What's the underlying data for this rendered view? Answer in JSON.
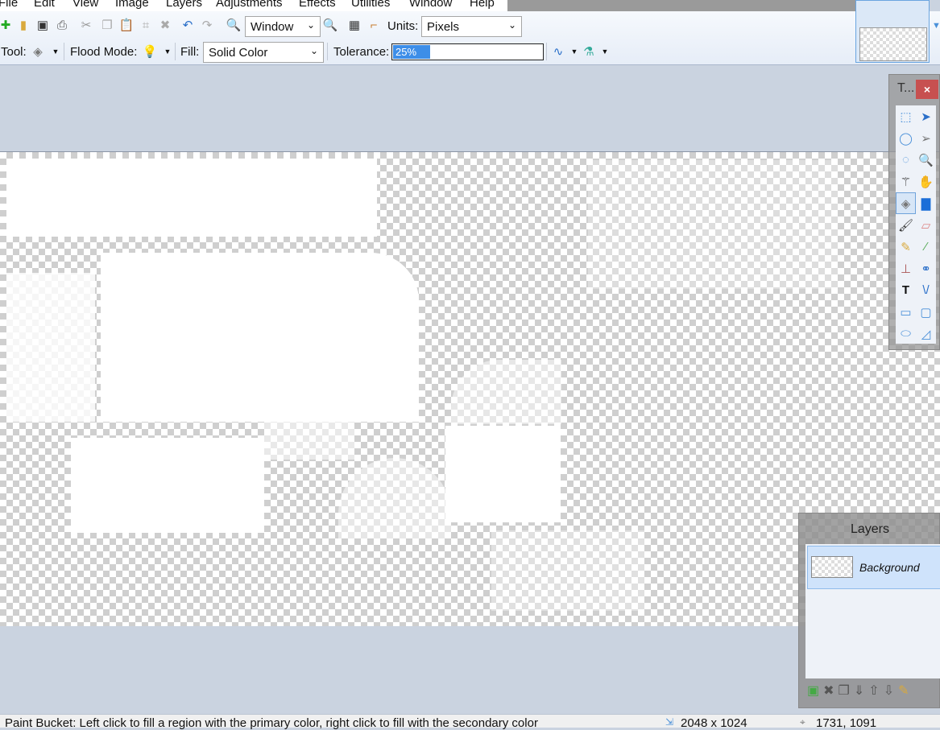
{
  "menu": [
    "File",
    "Edit",
    "View",
    "Image",
    "Layers",
    "Adjustments",
    "Effects",
    "Utilities",
    "Window",
    "Help"
  ],
  "toolbar": {
    "zoom_value": "Window",
    "units_label": "Units:",
    "units_value": "Pixels",
    "tool_label": "Tool:",
    "flood_mode_label": "Flood Mode:",
    "fill_label": "Fill:",
    "fill_value": "Solid Color",
    "tolerance_label": "Tolerance:",
    "tolerance_value": "25%",
    "tolerance_percent": 25,
    "accent": "#3d8ee8"
  },
  "tools_window": {
    "title": "T...",
    "close": "×",
    "active_tool": "paint-bucket"
  },
  "layers_panel": {
    "title": "Layers",
    "layers": [
      {
        "name": "Background",
        "selected": true
      }
    ]
  },
  "status": {
    "hint": "Paint Bucket: Left click to fill a region with the primary color, right click to fill with the secondary color",
    "image_size": "2048 x 1024",
    "cursor_position": "1731, 1091"
  }
}
